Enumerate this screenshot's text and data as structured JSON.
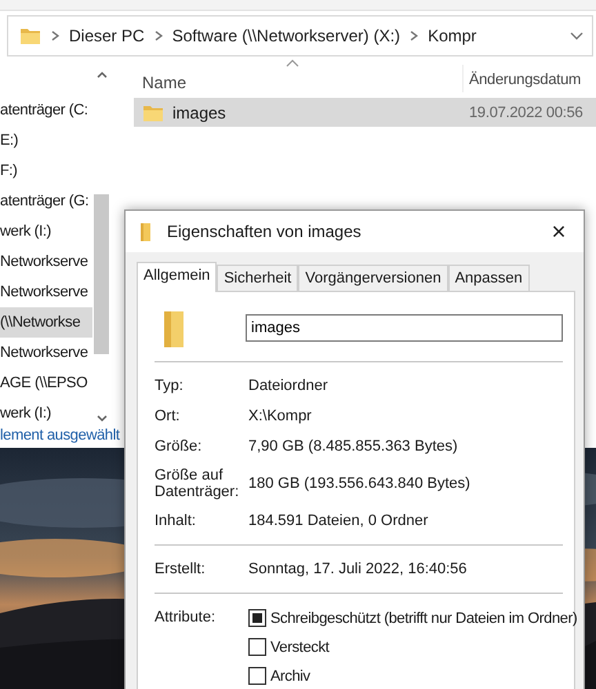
{
  "address_bar": {
    "segments": [
      "Dieser PC",
      "Software (\\\\Networkserver) (X:)",
      "Kompr"
    ]
  },
  "navigation_pane": {
    "items": [
      {
        "label": "atenträger (C:",
        "selected": false
      },
      {
        "label": "E:)",
        "selected": false
      },
      {
        "label": "F:)",
        "selected": false
      },
      {
        "label": "atenträger (G:",
        "selected": false
      },
      {
        "label": "werk (I:)",
        "selected": false
      },
      {
        "label": "Networkserve",
        "selected": false
      },
      {
        "label": "Networkserve",
        "selected": false
      },
      {
        "label": "(\\\\Networkse",
        "selected": true
      },
      {
        "label": "Networkserve",
        "selected": false
      },
      {
        "label": "AGE (\\\\EPSO",
        "selected": false
      },
      {
        "label": "werk (I:)",
        "selected": false
      }
    ]
  },
  "status_bar": "lement ausgewählt",
  "file_list": {
    "columns": [
      "Name",
      "Änderungsdatum"
    ],
    "rows": [
      {
        "name": "images",
        "modified": "19.07.2022 00:56",
        "selected": true
      }
    ]
  },
  "dialog": {
    "title": "Eigenschaften von images",
    "close": "×",
    "tabs": [
      {
        "label": "Allgemein",
        "selected": true
      },
      {
        "label": "Sicherheit",
        "selected": false
      },
      {
        "label": "Vorgängerversionen",
        "selected": false
      },
      {
        "label": "Anpassen",
        "selected": false
      }
    ],
    "name_field": "images",
    "groups": [
      [
        {
          "label": "Typ:",
          "value": "Dateiordner"
        },
        {
          "label": "Ort:",
          "value": "X:\\Kompr"
        },
        {
          "label": "Größe:",
          "value": "7,90 GB (8.485.855.363 Bytes)"
        },
        {
          "label": "Größe auf Datenträger:",
          "value": "180 GB (193.556.643.840 Bytes)"
        },
        {
          "label": "Inhalt:",
          "value": "184.591 Dateien, 0 Ordner"
        }
      ],
      [
        {
          "label": "Erstellt:",
          "value": "Sonntag, 17. Juli 2022, 16:40:56"
        }
      ]
    ],
    "attributes_label": "Attribute:",
    "attributes": [
      {
        "label": "Schreibgeschützt (betrifft nur Dateien im Ordner)",
        "checked": true,
        "indeterminate": true
      },
      {
        "label": "Versteckt",
        "checked": false,
        "indeterminate": false
      },
      {
        "label": "Archiv",
        "checked": false,
        "indeterminate": false
      }
    ]
  }
}
